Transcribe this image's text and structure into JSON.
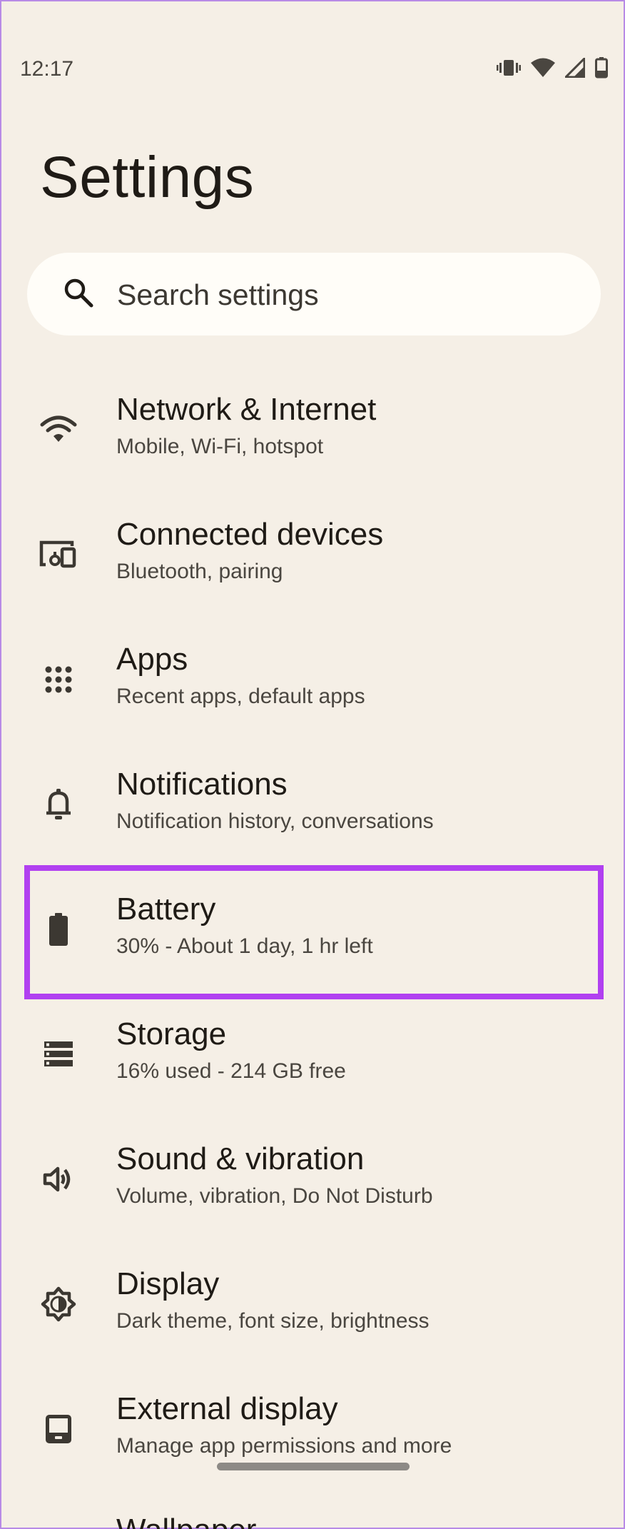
{
  "status_bar": {
    "time": "12:17",
    "icons": [
      "vibrate-icon",
      "wifi-icon",
      "signal-icon",
      "battery-icon"
    ]
  },
  "page": {
    "title": "Settings"
  },
  "search": {
    "placeholder": "Search settings"
  },
  "settings": [
    {
      "icon": "wifi-icon",
      "title": "Network & Internet",
      "subtitle": "Mobile, Wi-Fi, hotspot"
    },
    {
      "icon": "devices-icon",
      "title": "Connected devices",
      "subtitle": "Bluetooth, pairing"
    },
    {
      "icon": "apps-grid-icon",
      "title": "Apps",
      "subtitle": "Recent apps, default apps"
    },
    {
      "icon": "bell-icon",
      "title": "Notifications",
      "subtitle": "Notification history, conversations"
    },
    {
      "icon": "battery-icon",
      "title": "Battery",
      "subtitle": "30% - About 1 day, 1 hr left"
    },
    {
      "icon": "storage-icon",
      "title": "Storage",
      "subtitle": "16% used - 214 GB free"
    },
    {
      "icon": "speaker-icon",
      "title": "Sound & vibration",
      "subtitle": "Volume, vibration, Do Not Disturb"
    },
    {
      "icon": "brightness-icon",
      "title": "Display",
      "subtitle": "Dark theme, font size, brightness"
    },
    {
      "icon": "external-display-icon",
      "title": "External display",
      "subtitle": "Manage app permissions and more"
    }
  ],
  "partial_item": {
    "title": "Wallpaper"
  },
  "colors": {
    "background": "#f5efe6",
    "highlight": "#b140f0",
    "search_bg": "#fffdf8"
  }
}
